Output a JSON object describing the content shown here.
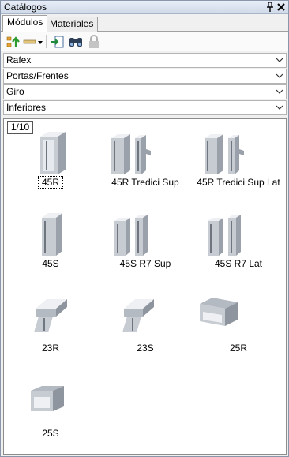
{
  "panel": {
    "title": "Catálogos",
    "pin_icon": "pin-icon",
    "close_icon": "close-icon"
  },
  "tabs": [
    {
      "label": "Módulos",
      "active": true
    },
    {
      "label": "Materiales",
      "active": false
    }
  ],
  "toolbar": {
    "icons": [
      "tree-upload-icon",
      "measure-dropdown-icon",
      "import-icon",
      "binoculars-icon",
      "lock-icon"
    ]
  },
  "filters": [
    {
      "value": "Rafex"
    },
    {
      "value": "Portas/Frentes"
    },
    {
      "value": "Giro"
    },
    {
      "value": "Inferiores"
    }
  ],
  "grid": {
    "page": "1/10",
    "items": [
      {
        "label": "45R",
        "icon": "profile-45r-icon",
        "selected": true
      },
      {
        "label": "45R Tredici Sup",
        "icon": "profile-45r-tredici-sup-icon"
      },
      {
        "label": "45R Tredici Sup Lat",
        "icon": "profile-45r-tredici-sup-lat-icon"
      },
      {
        "label": "45S",
        "icon": "profile-45s-icon"
      },
      {
        "label": "45S R7 Sup",
        "icon": "profile-45s-r7-sup-icon"
      },
      {
        "label": "45S R7 Lat",
        "icon": "profile-45s-r7-lat-icon"
      },
      {
        "label": "23R",
        "icon": "profile-23r-icon"
      },
      {
        "label": "23S",
        "icon": "profile-23s-icon"
      },
      {
        "label": "25R",
        "icon": "profile-25r-icon"
      },
      {
        "label": "25S",
        "icon": "profile-25s-icon"
      }
    ]
  },
  "colors": {
    "titlebar": "#cfd9e8",
    "profile_light": "#dfe3e8",
    "profile_mid": "#b4bac2",
    "profile_dark": "#7d848d"
  }
}
